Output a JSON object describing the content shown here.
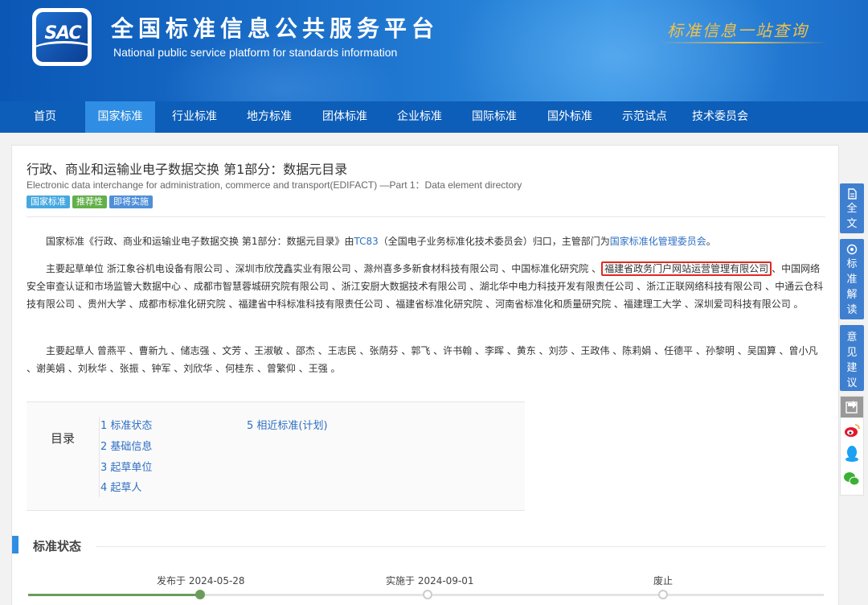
{
  "header": {
    "logo_text": "SAC",
    "title": "全国标准信息公共服务平台",
    "subtitle": "National public service platform  for standards information",
    "slogan": "标准信息一站查询"
  },
  "nav": {
    "items": [
      "首页",
      "国家标准",
      "行业标准",
      "地方标准",
      "团体标准",
      "企业标准",
      "国际标准",
      "国外标准",
      "示范试点",
      "技术委员会"
    ],
    "active": "国家标准"
  },
  "standard": {
    "title_cn": "行政、商业和运输业电子数据交换 第1部分：数据元目录",
    "title_en": "Electronic data interchange for administration, commerce and transport(EDIFACT) —Part 1：Data element directory",
    "tags": [
      "国家标准",
      "推荐性",
      "即将实施"
    ]
  },
  "intro": {
    "text_a": "国家标准《行政、商业和运输业电子数据交换 第1部分：数据元目录》由",
    "tc_link": "TC83",
    "text_b": "（全国电子业务标准化技术委员会）归口，主管部门为",
    "dept_link": "国家标准化管理委员会",
    "text_c": "。"
  },
  "drafting_units": {
    "label": "主要起草单位",
    "text_a": "浙江象谷机电设备有限公司 、深圳市欣茂鑫实业有限公司 、滁州喜多多新食材科技有限公司 、中国标准化研究院 、",
    "highlighted": "福建省政务门户网站运营管理有限公司",
    "text_b": "、中国网络安全审查认证和市场监管大数据中心 、成都市智慧蓉城研究院有限公司 、浙江安厨大数据技术有限公司 、湖北华中电力科技开发有限责任公司 、浙江正联网络科技有限公司 、中通云仓科技有限公司 、贵州大学 、成都市标准化研究院 、福建省中科标准科技有限责任公司 、福建省标准化研究院 、河南省标准化和质量研究院 、福建理工大学 、深圳爱司科技有限公司 。"
  },
  "drafters": {
    "label": "主要起草人",
    "text": "曾燕平 、曹新九 、储志强 、文芳 、王淑敏 、邵杰 、王志民 、张荫芬 、郭飞 、许书翰 、李晖 、黄东 、刘莎 、王政伟 、陈莉娟 、任德平 、孙黎明 、吴国算 、曾小凡 、谢美娟 、刘秋华 、张振 、钟军 、刘欣华 、何桂东 、曾繁仰 、王强 。"
  },
  "toc": {
    "heading": "目录",
    "items": [
      "1  标准状态",
      "2  基础信息",
      "3  起草单位",
      "4  起草人",
      "5  相近标准(计划)"
    ]
  },
  "status": {
    "heading": "标准状态",
    "published": "发布于 2024-05-28",
    "implemented": "实施于 2024-09-01",
    "abolished": "废止"
  },
  "side": {
    "fulltext": "全文",
    "interpret": "标准解读",
    "feedback": "意见建议"
  },
  "colors": {
    "nav": "#0d5eb8",
    "nav_active": "#2f8ee3",
    "link": "#2e6fc4",
    "highlight_border": "#e02a20",
    "timeline_done": "#6b9c5c"
  }
}
